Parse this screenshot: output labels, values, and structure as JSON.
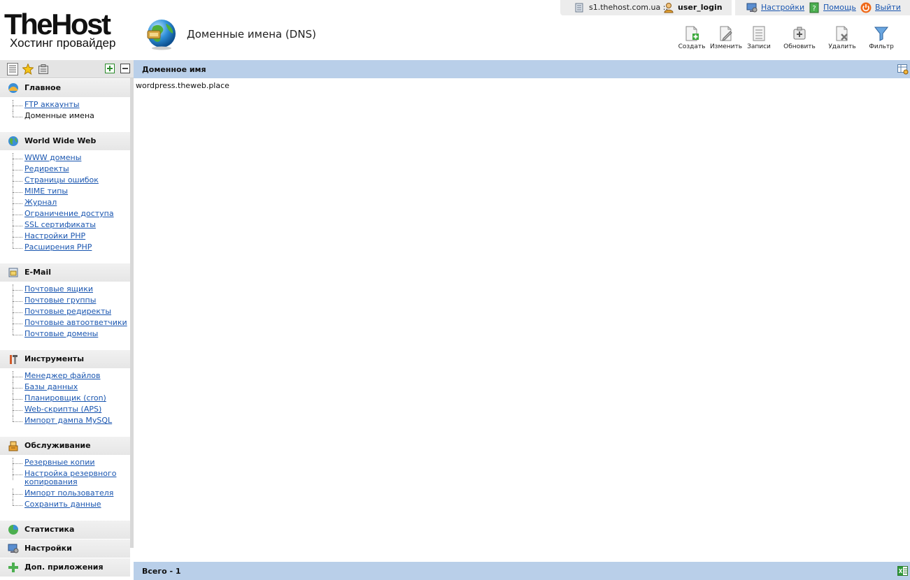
{
  "header": {
    "logo_brand": "TheHost",
    "logo_tagline": "Хостинг провайдер",
    "page_title": "Доменные имена (DNS)",
    "server": "s1.thehost.com.ua ::",
    "user": "user_login",
    "links": {
      "settings": "Настройки",
      "help": "Помощь",
      "logout": "Выйти"
    }
  },
  "toolbar": {
    "create": "Создать",
    "edit": "Изменить",
    "records": "Записи",
    "refresh": "Обновить",
    "delete": "Удалить",
    "filter": "Фильтр"
  },
  "sidebar": {
    "sections": [
      {
        "title": "Главное",
        "icon": "home-icon",
        "items": [
          "FTP аккаунты",
          "Доменные имена"
        ],
        "current": "Доменные имена"
      },
      {
        "title": "World Wide Web",
        "icon": "globe-icon",
        "items": [
          "WWW домены",
          "Редиректы",
          "Страницы ошибок",
          "MIME типы",
          "Журнал",
          "Ограничение доступа",
          "SSL сертификаты",
          "Настройки PHP",
          "Расширения PHP"
        ]
      },
      {
        "title": "E-Mail",
        "icon": "mail-icon",
        "items": [
          "Почтовые ящики",
          "Почтовые группы",
          "Почтовые редиректы",
          "Почтовые автоответчики",
          "Почтовые домены"
        ]
      },
      {
        "title": "Инструменты",
        "icon": "tools-icon",
        "items": [
          "Менеджер файлов",
          "Базы данных",
          "Планировщик (cron)",
          "Web-скрипты (APS)",
          "Импорт дампа MySQL"
        ]
      },
      {
        "title": "Обслуживание",
        "icon": "maintenance-icon",
        "items": [
          "Резервные копии",
          "Настройка резервного копирования",
          "Импорт пользователя",
          "Сохранить данные"
        ]
      },
      {
        "title": "Статистика",
        "icon": "statistics-icon",
        "items": []
      },
      {
        "title": "Настройки",
        "icon": "settings-icon",
        "items": []
      },
      {
        "title": "Доп. приложения",
        "icon": "plus-icon",
        "items": []
      }
    ]
  },
  "table": {
    "column": "Доменное имя",
    "rows": [
      "wordpress.theweb.place"
    ],
    "total": "Всего - 1"
  }
}
